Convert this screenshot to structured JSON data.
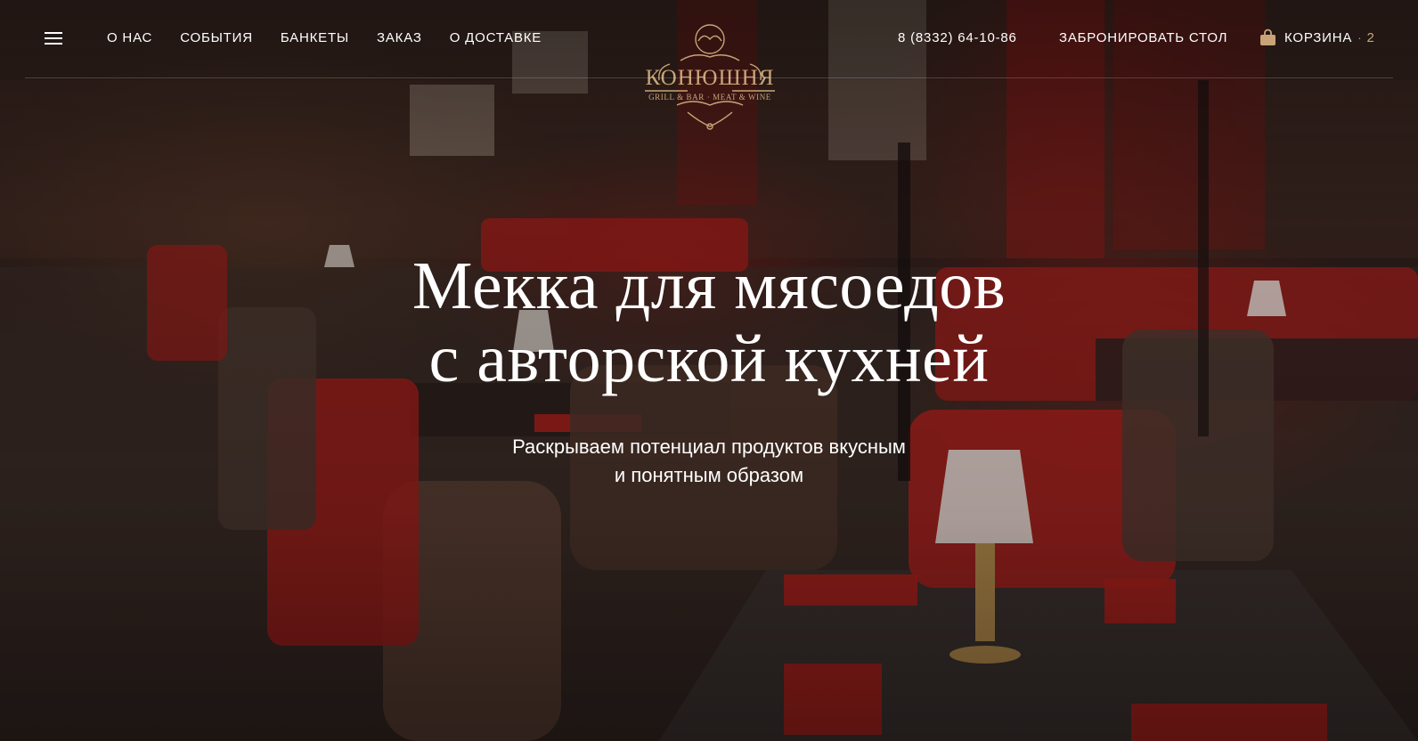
{
  "header": {
    "nav": [
      {
        "label": "О НАС"
      },
      {
        "label": "СОБЫТИЯ"
      },
      {
        "label": "БАНКЕТЫ"
      },
      {
        "label": "ЗАКАЗ"
      },
      {
        "label": "О ДОСТАВКЕ"
      }
    ],
    "logo": {
      "title": "КОНЮШНЯ",
      "subtitle": "GRILL & BAR · MEAT & WINE"
    },
    "phone": "8 (8332) 64-10-86",
    "book_label": "ЗАБРОНИРОВАТЬ СТОЛ",
    "cart": {
      "label": "КОРЗИНА",
      "separator": "·",
      "count": "2"
    }
  },
  "hero": {
    "title_line1": "Мекка для мясоедов",
    "title_line2": "с авторской кухней",
    "subtitle_line1": "Раскрываем потенциал продуктов вкусным",
    "subtitle_line2": "и понятным образом"
  },
  "colors": {
    "accent_gold": "#caa478",
    "text": "#ffffff",
    "upholstery_red": "#b3201c"
  },
  "icons": {
    "menu": "hamburger-menu-icon",
    "cart": "shopping-bag-icon"
  }
}
